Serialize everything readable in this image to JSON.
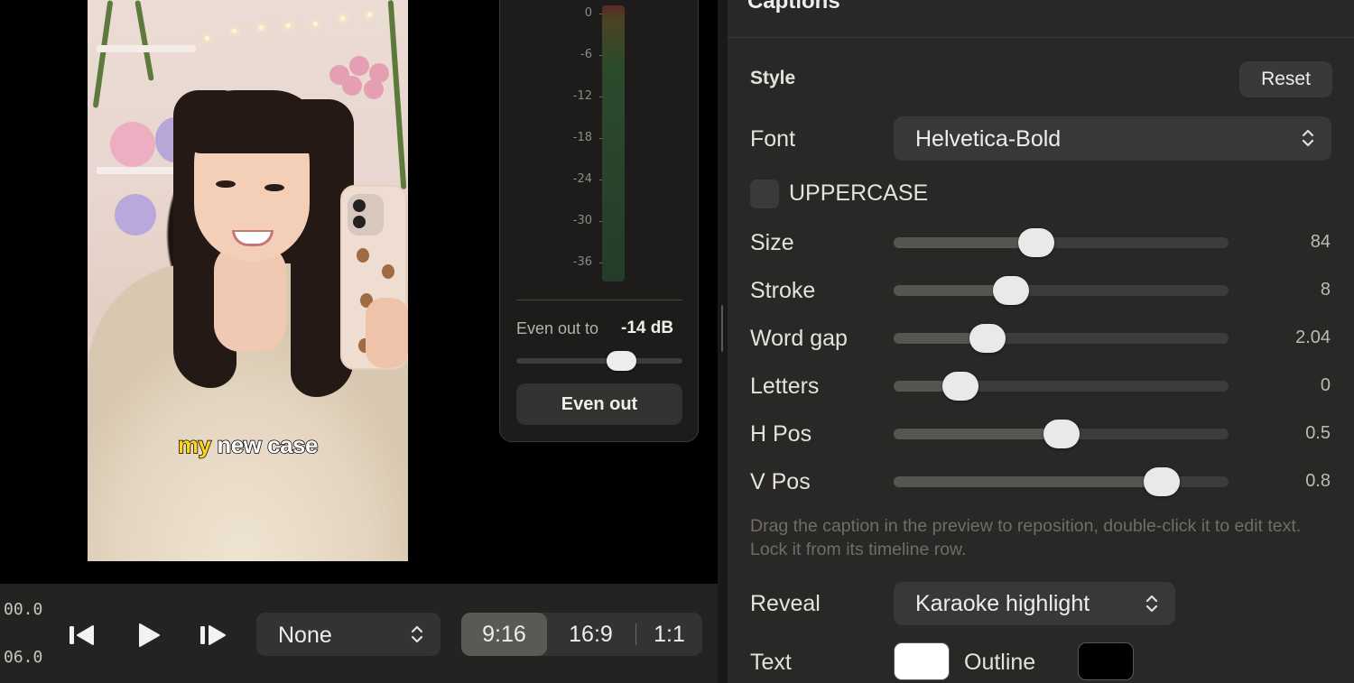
{
  "preview": {
    "caption_words": [
      "my",
      "new case"
    ],
    "colors": {
      "highlight": "#ffd31a",
      "text": "#ffffff",
      "stroke": "#000000"
    }
  },
  "meter": {
    "ticks": [
      "0",
      "-6",
      "-12",
      "-18",
      "-24",
      "-30",
      "-36"
    ],
    "even_out_label": "Even out to",
    "even_out_value": "-14 dB",
    "even_out_level": 0.63,
    "even_out_button": "Even out"
  },
  "transport": {
    "time_start": "00.0",
    "time_end": "06.0",
    "prev_icon": "skip-back-icon",
    "play_icon": "play-icon",
    "next_icon": "skip-forward-icon",
    "speed_value": "None",
    "aspects": [
      "9:16",
      "16:9",
      "1:1"
    ],
    "aspect_selected": "9:16"
  },
  "captions": {
    "title": "Captions",
    "style_heading": "Style",
    "reset_label": "Reset",
    "font_label": "Font",
    "font_value": "Helvetica-Bold",
    "uppercase_label": "UPPERCASE",
    "uppercase_checked": false,
    "sliders": [
      {
        "label": "Size",
        "value": "84",
        "level": 0.425
      },
      {
        "label": "Stroke",
        "value": "8",
        "level": 0.35
      },
      {
        "label": "Word gap",
        "value": "2.04",
        "level": 0.28
      },
      {
        "label": "Letters",
        "value": "0",
        "level": 0.2
      },
      {
        "label": "H Pos",
        "value": "0.5",
        "level": 0.5
      },
      {
        "label": "V Pos",
        "value": "0.8",
        "level": 0.8
      }
    ],
    "hint": "Drag the caption in the preview to reposition, double-click it to edit text. Lock it from its timeline row.",
    "reveal_label": "Reveal",
    "reveal_value": "Karaoke highlight",
    "text_label": "Text",
    "outline_label": "Outline",
    "text_color": "#ffffff",
    "outline_color": "#000000"
  }
}
